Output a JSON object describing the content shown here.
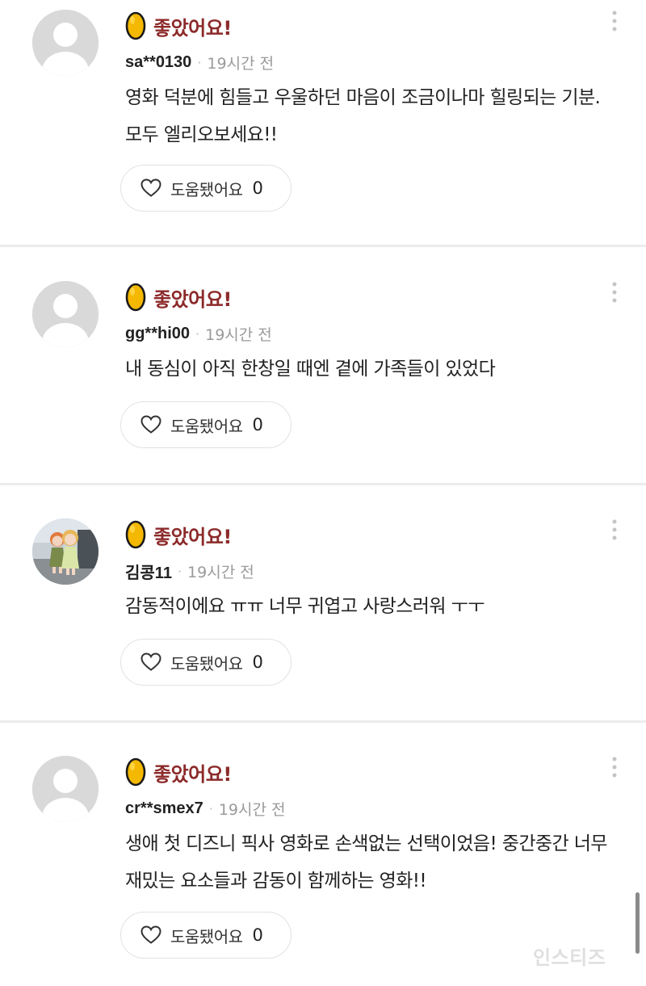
{
  "comments": [
    {
      "rating_label": "좋았어요!",
      "username": "sa**0130",
      "time": "19시간 전",
      "text": "영화 덕분에 힘들고 우울하던 마음이 조금이나마 힐링되는 기분. 모두 엘리오보세요!!",
      "helpful_label": "도움됐어요",
      "helpful_count": "0",
      "avatar": "default-avatar"
    },
    {
      "rating_label": "좋았어요!",
      "username": "gg**hi00",
      "time": "19시간 전",
      "text": "내 동심이 아직 한창일 때엔 곁에 가족들이 있었다",
      "helpful_label": "도움됐어요",
      "helpful_count": "0",
      "avatar": "default-avatar"
    },
    {
      "rating_label": "좋았어요!",
      "username": "김콩11",
      "time": "19시간 전",
      "text": "감동적이에요 ㅠㅠ 너무 귀엽고 사랑스러워 ㅜㅜ",
      "helpful_label": "도움됐어요",
      "helpful_count": "0",
      "avatar": "photo-avatar-dolls"
    },
    {
      "rating_label": "좋았어요!",
      "username": "cr**smex7",
      "time": "19시간 전",
      "text": "생애 첫 디즈니 픽사 영화로 손색없는 선택이었음! 중간중간 너무 재밌는 요소들과 감동이 함께하는 영화!!",
      "helpful_label": "도움됐어요",
      "helpful_count": "0",
      "avatar": "default-avatar"
    }
  ],
  "watermark": "인스티즈",
  "colors": {
    "rating_label": "#8c2a2a",
    "egg_fill": "#f5b800",
    "egg_outline": "#1a1a1a",
    "divider": "#ececec",
    "avatar_bg": "#d9d9d9"
  },
  "icons": {
    "rating": "golden-egg-icon",
    "helpful": "heart-outline-icon",
    "menu": "more-vertical-icon"
  }
}
